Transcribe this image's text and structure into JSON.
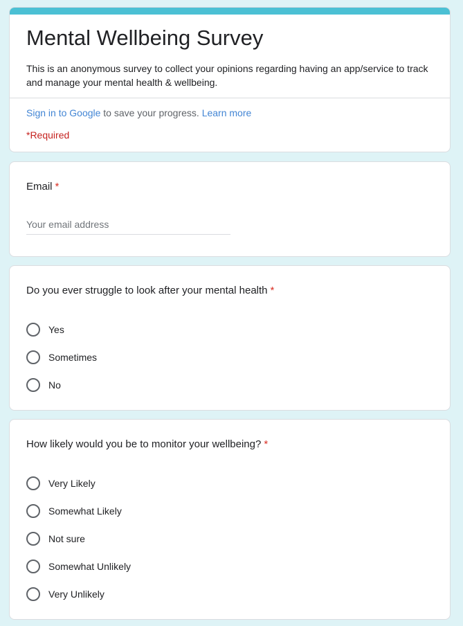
{
  "form": {
    "title": "Mental Wellbeing Survey",
    "description": "This is an anonymous survey to collect your opinions regarding having an app/service to track and manage your mental health & wellbeing.",
    "sign_in_link": "Sign in to Google",
    "sign_in_text": " to save your progress. ",
    "learn_more_link": "Learn more",
    "required_note": "*Required",
    "accent_color": "#4bc0d4",
    "background_color": "#def3f6"
  },
  "email_question": {
    "title": "Email",
    "required_mark": "*",
    "placeholder": "Your email address"
  },
  "question1": {
    "title": "Do you ever struggle to look after your mental health",
    "required_mark": "*",
    "options": [
      "Yes",
      "Sometimes",
      "No"
    ]
  },
  "question2": {
    "title": "How likely would you be to monitor your wellbeing?",
    "required_mark": "*",
    "options": [
      "Very Likely",
      "Somewhat Likely",
      "Not sure",
      "Somewhat Unlikely",
      "Very Unlikely"
    ]
  }
}
